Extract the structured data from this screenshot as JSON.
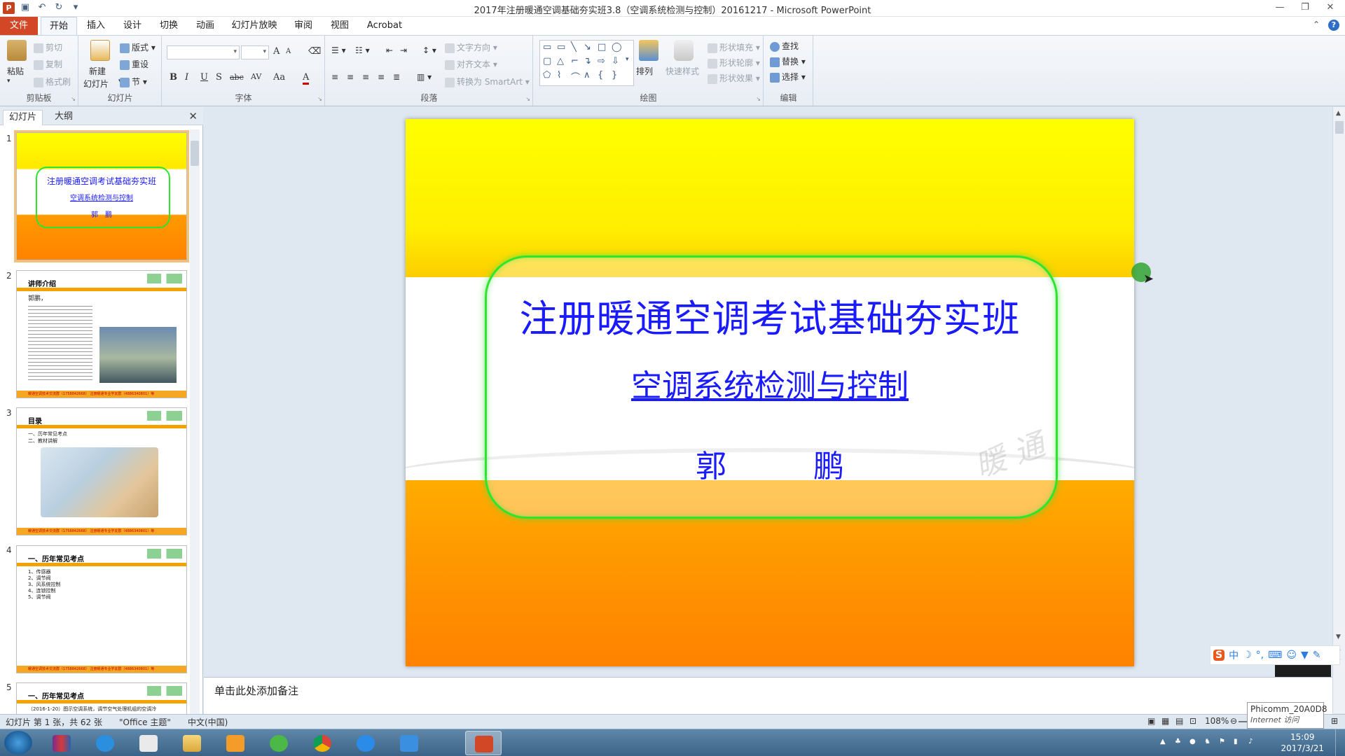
{
  "window": {
    "title": "2017年注册暖通空调基础夯实班3.8（空调系统检测与控制）20161217 - Microsoft PowerPoint",
    "app_icon_letter": "P"
  },
  "ribbon_tabs": [
    {
      "label": "文件",
      "name": "tab-file"
    },
    {
      "label": "开始",
      "name": "tab-home"
    },
    {
      "label": "插入",
      "name": "tab-insert"
    },
    {
      "label": "设计",
      "name": "tab-design"
    },
    {
      "label": "切换",
      "name": "tab-transitions"
    },
    {
      "label": "动画",
      "name": "tab-animations"
    },
    {
      "label": "幻灯片放映",
      "name": "tab-slideshow"
    },
    {
      "label": "审阅",
      "name": "tab-review"
    },
    {
      "label": "视图",
      "name": "tab-view"
    },
    {
      "label": "Acrobat",
      "name": "tab-acrobat"
    }
  ],
  "ribbon": {
    "clipboard": {
      "paste": "粘贴",
      "cut": "剪切",
      "copy": "复制",
      "format_painter": "格式刷",
      "label": "剪贴板"
    },
    "slides": {
      "new_slide_1": "新建",
      "new_slide_2": "幻灯片",
      "layout": "版式",
      "reset": "重设",
      "section": "节",
      "label": "幻灯片"
    },
    "font": {
      "label": "字体",
      "bold": "B",
      "italic": "I",
      "underline": "U",
      "strike": "S",
      "abc": "abc",
      "spacing": "AV",
      "case": "Aa",
      "color": "A",
      "grow": "A",
      "shrink": "A"
    },
    "paragraph": {
      "text_direction": "文字方向",
      "align_text": "对齐文本",
      "smartart": "转换为 SmartArt",
      "label": "段落"
    },
    "drawing": {
      "arrange": "排列",
      "quick_styles": "快速样式",
      "shape_fill": "形状填充",
      "shape_outline": "形状轮廓",
      "shape_effects": "形状效果",
      "label": "绘图"
    },
    "editing": {
      "find": "查找",
      "replace": "替换",
      "select": "选择",
      "label": "编辑"
    }
  },
  "left_panel": {
    "tab_slides": "幻灯片",
    "tab_outline": "大纲",
    "thumbnails": [
      {
        "num": "1",
        "title": "注册暖通空调考试基础夯实班",
        "subtitle": "空调系统检测与控制",
        "author": "郭　鹏"
      },
      {
        "num": "2",
        "title": "讲师介绍",
        "name": "郭鹏，",
        "footer": "暖通空调技术交流群（1758842668）  注册暖通专业学友群（4886340801）等"
      },
      {
        "num": "3",
        "title": "目录",
        "items": [
          "一、历年常见考点",
          "二、教材讲解"
        ],
        "footer": "暖通空调技术交流群（1758842668）  注册暖通专业学友群（4886340801）等"
      },
      {
        "num": "4",
        "title": "一、历年常见考点",
        "items": [
          "1、传感器",
          "2、调节阀",
          "3、风系统控制",
          "4、连锁控制",
          "5、调节阀"
        ],
        "footer": "暖通空调技术交流群（1758842668）  注册暖通专业学友群（4886340801）等"
      },
      {
        "num": "5",
        "title": "一、历年常见考点",
        "items": [
          "（2016-1-20）图示空调系统，调节空气处理机组的空调冷"
        ]
      }
    ]
  },
  "slide": {
    "title": "注册暖通空调考试基础夯实班",
    "subtitle": "空调系统检测与控制",
    "author": "郭　鹏",
    "watermark": "暖 通"
  },
  "notes": {
    "placeholder": "单击此处添加备注"
  },
  "ime": {
    "logo": "S",
    "mode": "中"
  },
  "status": {
    "slide_info": "幻灯片 第 1 张，共 62 张",
    "theme": "\"Office 主题\"",
    "language": "中文(中国)",
    "zoom": "108%"
  },
  "tooltip": {
    "line1": "Phicomm_20A0D8",
    "line2": "Internet 访问"
  },
  "taskbar": {
    "time": "15:09",
    "date": "2017/3/21"
  },
  "colors": {
    "slide_text": "#1a1aff",
    "file_tab": "#d24726",
    "frame_green": "#2ee52e"
  }
}
